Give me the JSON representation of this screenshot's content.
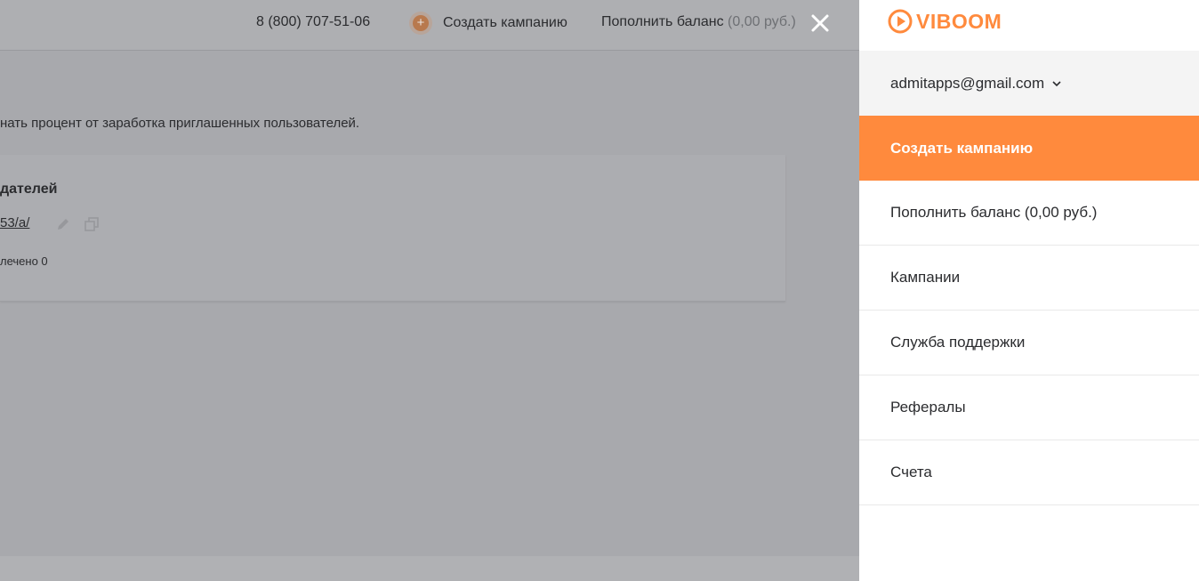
{
  "header": {
    "phone": "8 (800) 707-51-06",
    "create_campaign": "Создать кампанию",
    "balance_label": "Пополнить баланс",
    "balance_amount": "(0,00 руб.)"
  },
  "background": {
    "description": "нать процент от заработка приглашенных пользователей.",
    "card_title": "дателей",
    "card_link": "53/a/",
    "card_count": "лечено 0"
  },
  "drawer": {
    "logo": "VIBOOM",
    "account_email": "admitapps@gmail.com",
    "menu": [
      {
        "label": "Создать кампанию",
        "active": true
      },
      {
        "label": "Пополнить баланс (0,00 руб.)",
        "active": false
      },
      {
        "label": "Кампании",
        "active": false
      },
      {
        "label": "Служба поддержки",
        "active": false
      },
      {
        "label": "Рефералы",
        "active": false
      },
      {
        "label": "Счета",
        "active": false
      }
    ]
  },
  "colors": {
    "accent": "#ff8a3d",
    "overlay": "#a8a9ad"
  },
  "icons": {
    "close": "close-icon",
    "plus": "plus-icon",
    "edit": "pencil-icon",
    "copy": "copy-icon",
    "chevron": "chevron-down-icon",
    "logo": "play-icon"
  }
}
